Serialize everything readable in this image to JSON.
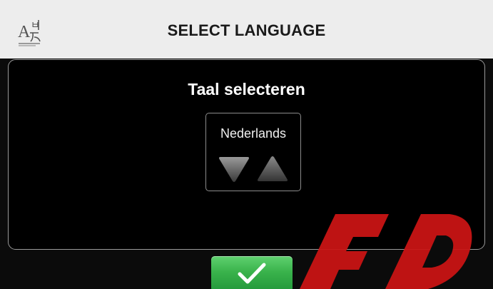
{
  "header": {
    "title": "SELECT LANGUAGE",
    "icon": "language-icon"
  },
  "panel": {
    "title": "Taal selecteren"
  },
  "language_selector": {
    "selected_value": "Nederlands",
    "down_icon": "triangle-down-icon",
    "up_icon": "triangle-up-icon"
  },
  "confirm": {
    "icon": "checkmark-icon"
  },
  "colors": {
    "header_bg": "#ededed",
    "screen_bg": "#000000",
    "confirm_green": "#39b24b",
    "watermark_red": "#c81414"
  }
}
